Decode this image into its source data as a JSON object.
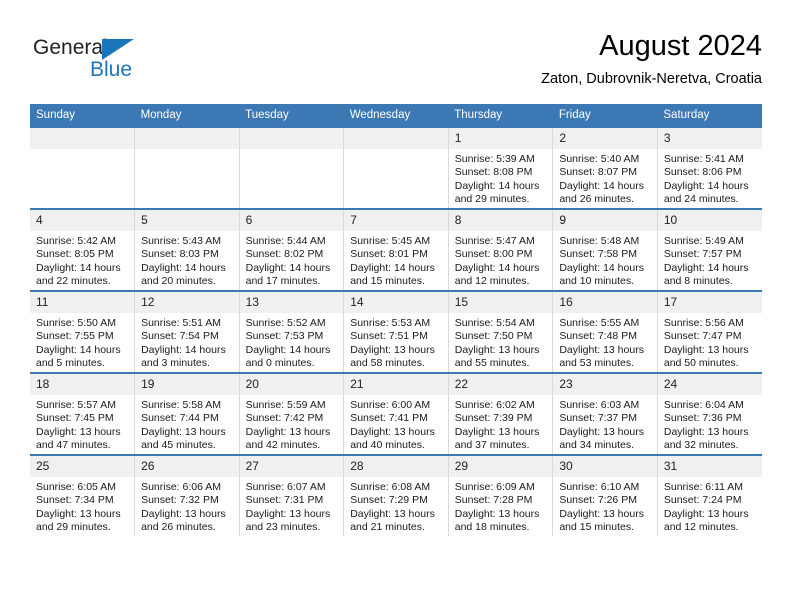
{
  "brand": {
    "name_top": "General",
    "name_bottom": "Blue",
    "accent_color": "#1b75bb",
    "triangle_icon": "triangle-icon"
  },
  "header": {
    "title": "August 2024",
    "subtitle": "Zaton, Dubrovnik-Neretva, Croatia"
  },
  "theme": {
    "header_row_bg": "#3c78b4",
    "header_row_text": "#ffffff",
    "daynum_bg": "#f0f0f0",
    "row_divider": "#3c78b4",
    "cell_divider": "#d9d9d9"
  },
  "weekdays": [
    "Sunday",
    "Monday",
    "Tuesday",
    "Wednesday",
    "Thursday",
    "Friday",
    "Saturday"
  ],
  "labels": {
    "sunrise": "Sunrise:",
    "sunset": "Sunset:",
    "daylight": "Daylight:"
  },
  "weeks": [
    [
      {
        "day": "",
        "empty": true
      },
      {
        "day": "",
        "empty": true
      },
      {
        "day": "",
        "empty": true
      },
      {
        "day": "",
        "empty": true
      },
      {
        "day": "1",
        "sunrise": "Sunrise: 5:39 AM",
        "sunset": "Sunset: 8:08 PM",
        "daylight_line1": "Daylight: 14 hours",
        "daylight_line2": "and 29 minutes."
      },
      {
        "day": "2",
        "sunrise": "Sunrise: 5:40 AM",
        "sunset": "Sunset: 8:07 PM",
        "daylight_line1": "Daylight: 14 hours",
        "daylight_line2": "and 26 minutes."
      },
      {
        "day": "3",
        "sunrise": "Sunrise: 5:41 AM",
        "sunset": "Sunset: 8:06 PM",
        "daylight_line1": "Daylight: 14 hours",
        "daylight_line2": "and 24 minutes."
      }
    ],
    [
      {
        "day": "4",
        "sunrise": "Sunrise: 5:42 AM",
        "sunset": "Sunset: 8:05 PM",
        "daylight_line1": "Daylight: 14 hours",
        "daylight_line2": "and 22 minutes."
      },
      {
        "day": "5",
        "sunrise": "Sunrise: 5:43 AM",
        "sunset": "Sunset: 8:03 PM",
        "daylight_line1": "Daylight: 14 hours",
        "daylight_line2": "and 20 minutes."
      },
      {
        "day": "6",
        "sunrise": "Sunrise: 5:44 AM",
        "sunset": "Sunset: 8:02 PM",
        "daylight_line1": "Daylight: 14 hours",
        "daylight_line2": "and 17 minutes."
      },
      {
        "day": "7",
        "sunrise": "Sunrise: 5:45 AM",
        "sunset": "Sunset: 8:01 PM",
        "daylight_line1": "Daylight: 14 hours",
        "daylight_line2": "and 15 minutes."
      },
      {
        "day": "8",
        "sunrise": "Sunrise: 5:47 AM",
        "sunset": "Sunset: 8:00 PM",
        "daylight_line1": "Daylight: 14 hours",
        "daylight_line2": "and 12 minutes."
      },
      {
        "day": "9",
        "sunrise": "Sunrise: 5:48 AM",
        "sunset": "Sunset: 7:58 PM",
        "daylight_line1": "Daylight: 14 hours",
        "daylight_line2": "and 10 minutes."
      },
      {
        "day": "10",
        "sunrise": "Sunrise: 5:49 AM",
        "sunset": "Sunset: 7:57 PM",
        "daylight_line1": "Daylight: 14 hours",
        "daylight_line2": "and 8 minutes."
      }
    ],
    [
      {
        "day": "11",
        "sunrise": "Sunrise: 5:50 AM",
        "sunset": "Sunset: 7:55 PM",
        "daylight_line1": "Daylight: 14 hours",
        "daylight_line2": "and 5 minutes."
      },
      {
        "day": "12",
        "sunrise": "Sunrise: 5:51 AM",
        "sunset": "Sunset: 7:54 PM",
        "daylight_line1": "Daylight: 14 hours",
        "daylight_line2": "and 3 minutes."
      },
      {
        "day": "13",
        "sunrise": "Sunrise: 5:52 AM",
        "sunset": "Sunset: 7:53 PM",
        "daylight_line1": "Daylight: 14 hours",
        "daylight_line2": "and 0 minutes."
      },
      {
        "day": "14",
        "sunrise": "Sunrise: 5:53 AM",
        "sunset": "Sunset: 7:51 PM",
        "daylight_line1": "Daylight: 13 hours",
        "daylight_line2": "and 58 minutes."
      },
      {
        "day": "15",
        "sunrise": "Sunrise: 5:54 AM",
        "sunset": "Sunset: 7:50 PM",
        "daylight_line1": "Daylight: 13 hours",
        "daylight_line2": "and 55 minutes."
      },
      {
        "day": "16",
        "sunrise": "Sunrise: 5:55 AM",
        "sunset": "Sunset: 7:48 PM",
        "daylight_line1": "Daylight: 13 hours",
        "daylight_line2": "and 53 minutes."
      },
      {
        "day": "17",
        "sunrise": "Sunrise: 5:56 AM",
        "sunset": "Sunset: 7:47 PM",
        "daylight_line1": "Daylight: 13 hours",
        "daylight_line2": "and 50 minutes."
      }
    ],
    [
      {
        "day": "18",
        "sunrise": "Sunrise: 5:57 AM",
        "sunset": "Sunset: 7:45 PM",
        "daylight_line1": "Daylight: 13 hours",
        "daylight_line2": "and 47 minutes."
      },
      {
        "day": "19",
        "sunrise": "Sunrise: 5:58 AM",
        "sunset": "Sunset: 7:44 PM",
        "daylight_line1": "Daylight: 13 hours",
        "daylight_line2": "and 45 minutes."
      },
      {
        "day": "20",
        "sunrise": "Sunrise: 5:59 AM",
        "sunset": "Sunset: 7:42 PM",
        "daylight_line1": "Daylight: 13 hours",
        "daylight_line2": "and 42 minutes."
      },
      {
        "day": "21",
        "sunrise": "Sunrise: 6:00 AM",
        "sunset": "Sunset: 7:41 PM",
        "daylight_line1": "Daylight: 13 hours",
        "daylight_line2": "and 40 minutes."
      },
      {
        "day": "22",
        "sunrise": "Sunrise: 6:02 AM",
        "sunset": "Sunset: 7:39 PM",
        "daylight_line1": "Daylight: 13 hours",
        "daylight_line2": "and 37 minutes."
      },
      {
        "day": "23",
        "sunrise": "Sunrise: 6:03 AM",
        "sunset": "Sunset: 7:37 PM",
        "daylight_line1": "Daylight: 13 hours",
        "daylight_line2": "and 34 minutes."
      },
      {
        "day": "24",
        "sunrise": "Sunrise: 6:04 AM",
        "sunset": "Sunset: 7:36 PM",
        "daylight_line1": "Daylight: 13 hours",
        "daylight_line2": "and 32 minutes."
      }
    ],
    [
      {
        "day": "25",
        "sunrise": "Sunrise: 6:05 AM",
        "sunset": "Sunset: 7:34 PM",
        "daylight_line1": "Daylight: 13 hours",
        "daylight_line2": "and 29 minutes."
      },
      {
        "day": "26",
        "sunrise": "Sunrise: 6:06 AM",
        "sunset": "Sunset: 7:32 PM",
        "daylight_line1": "Daylight: 13 hours",
        "daylight_line2": "and 26 minutes."
      },
      {
        "day": "27",
        "sunrise": "Sunrise: 6:07 AM",
        "sunset": "Sunset: 7:31 PM",
        "daylight_line1": "Daylight: 13 hours",
        "daylight_line2": "and 23 minutes."
      },
      {
        "day": "28",
        "sunrise": "Sunrise: 6:08 AM",
        "sunset": "Sunset: 7:29 PM",
        "daylight_line1": "Daylight: 13 hours",
        "daylight_line2": "and 21 minutes."
      },
      {
        "day": "29",
        "sunrise": "Sunrise: 6:09 AM",
        "sunset": "Sunset: 7:28 PM",
        "daylight_line1": "Daylight: 13 hours",
        "daylight_line2": "and 18 minutes."
      },
      {
        "day": "30",
        "sunrise": "Sunrise: 6:10 AM",
        "sunset": "Sunset: 7:26 PM",
        "daylight_line1": "Daylight: 13 hours",
        "daylight_line2": "and 15 minutes."
      },
      {
        "day": "31",
        "sunrise": "Sunrise: 6:11 AM",
        "sunset": "Sunset: 7:24 PM",
        "daylight_line1": "Daylight: 13 hours",
        "daylight_line2": "and 12 minutes."
      }
    ]
  ]
}
